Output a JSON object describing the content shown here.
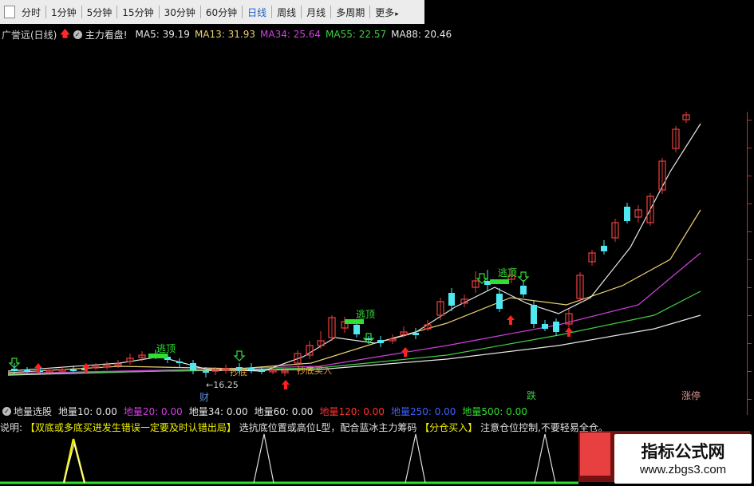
{
  "toolbar": {
    "items": [
      {
        "label": "分时"
      },
      {
        "label": "1分钟"
      },
      {
        "label": "5分钟"
      },
      {
        "label": "15分钟"
      },
      {
        "label": "30分钟"
      },
      {
        "label": "60分钟"
      },
      {
        "label": "日线"
      },
      {
        "label": "周线"
      },
      {
        "label": "月线"
      },
      {
        "label": "多周期"
      },
      {
        "label": "更多"
      }
    ],
    "more_arrow": "▸",
    "active_index": 6
  },
  "title_bar": {
    "stock_name": "广誉远(日线)",
    "formula_name": "主力看盘!",
    "ma": [
      {
        "label": "MA5: 39.19",
        "color": "#e6e6e6"
      },
      {
        "label": "MA13: 31.93",
        "color": "#e8d070"
      },
      {
        "label": "MA34: 25.64",
        "color": "#d040e0"
      },
      {
        "label": "MA55: 22.57",
        "color": "#40d040"
      },
      {
        "label": "MA88: 20.46",
        "color": "#e6e6e6"
      }
    ]
  },
  "chart_labels": {
    "top_label": "逃顶",
    "bottom_label": "抄底",
    "buy_label": "抄底买入",
    "low_price": "16.25",
    "cai": "财",
    "die": "跌",
    "zhangting": "涨停"
  },
  "volume_bar": {
    "name": "地量选股",
    "items": [
      {
        "label": "地量10: 0.00",
        "color": "#e6e6e6"
      },
      {
        "label": "地量20: 0.00",
        "color": "#d040e0"
      },
      {
        "label": "地量34: 0.00",
        "color": "#e6e6e6"
      },
      {
        "label": "地量60: 0.00",
        "color": "#e6e6e6"
      },
      {
        "label": "地量120: 0.00",
        "color": "#ff3030"
      },
      {
        "label": "地量250: 0.00",
        "color": "#4060ff"
      },
      {
        "label": "地量500: 0.00",
        "color": "#30e030"
      }
    ]
  },
  "description": {
    "label": "说明:",
    "text1": "【双底或多底买进发生错误一定要及时认错出局】",
    "text2": "选抗底位置或高位L型，配合蓝冰主力筹码",
    "text3": "【分仓买入】",
    "text4": "注意仓位控制,不要轻易全仓。"
  },
  "watermark": {
    "title": "指标公式网",
    "url": "www.zbgs3.com"
  },
  "colors": {
    "up_candle": "#e03c3c",
    "down_candle": "#50e8f0",
    "ma5": "#e6e6e6",
    "ma13": "#e8d070",
    "ma34": "#d040e0",
    "ma55": "#40d040",
    "ma88": "#e6e6e6",
    "signal_green": "#30e030"
  }
}
